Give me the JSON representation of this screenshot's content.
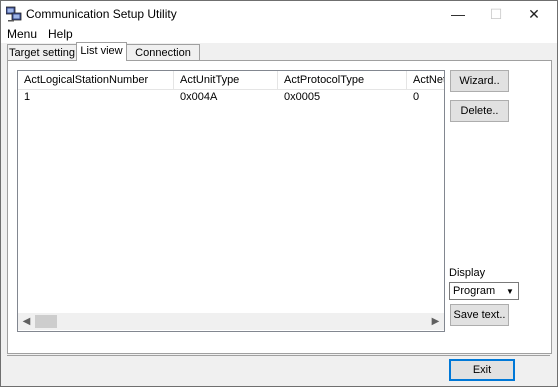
{
  "window": {
    "title": "Communication Setup Utility",
    "controls": {
      "minimize": "—",
      "maximize": "☐",
      "close": "✕"
    }
  },
  "menu": [
    {
      "label": "Menu"
    },
    {
      "label": "Help"
    }
  ],
  "tabs": [
    {
      "label": "Target setting",
      "active": false
    },
    {
      "label": "List view",
      "active": true
    },
    {
      "label": "Connection test",
      "active": false
    }
  ],
  "listview": {
    "columns": [
      "ActLogicalStationNumber",
      "ActUnitType",
      "ActProtocolType",
      "ActNetw"
    ],
    "rows": [
      [
        "1",
        "0x004A",
        "0x0005",
        "0"
      ]
    ]
  },
  "buttons": {
    "wizard": "Wizard..",
    "delete": "Delete..",
    "save_text": "Save text..",
    "exit": "Exit"
  },
  "display": {
    "label": "Display",
    "selected": "Program"
  },
  "icons": {
    "app": "computer-icon",
    "scroll_left": "chevron-left-icon",
    "scroll_right": "chevron-right-icon",
    "dropdown": "triangle-down-icon"
  }
}
